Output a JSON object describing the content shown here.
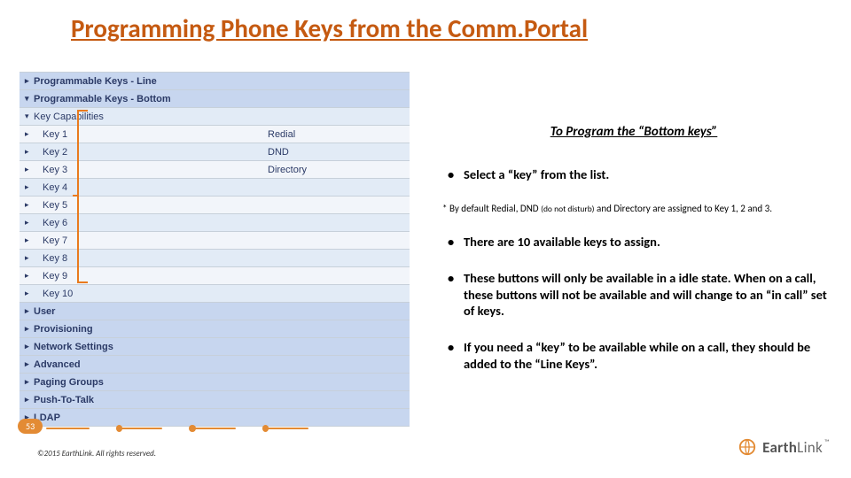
{
  "title": "Programming Phone Keys from the Comm.Portal",
  "panel": {
    "top_sections": [
      "Programmable Keys - Line",
      "Programmable Keys - Bottom"
    ],
    "capabilities_label": "Key Capabilities",
    "keys": [
      {
        "label": "Key 1",
        "value": "Redial"
      },
      {
        "label": "Key 2",
        "value": "DND"
      },
      {
        "label": "Key 3",
        "value": "Directory"
      },
      {
        "label": "Key 4",
        "value": ""
      },
      {
        "label": "Key 5",
        "value": ""
      },
      {
        "label": "Key 6",
        "value": ""
      },
      {
        "label": "Key 7",
        "value": ""
      },
      {
        "label": "Key 8",
        "value": ""
      },
      {
        "label": "Key 9",
        "value": ""
      },
      {
        "label": "Key 10",
        "value": ""
      }
    ],
    "bottom_sections": [
      "User",
      "Provisioning",
      "Network Settings",
      "Advanced",
      "Paging Groups",
      "Push-To-Talk",
      "LDAP"
    ]
  },
  "content": {
    "subhead": "To Program the “Bottom keys”",
    "bullets_a": [
      "Select a “key” from the list."
    ],
    "note_pre": "* By default Redial, DND ",
    "note_small": "(do not disturb)",
    "note_post": " and Directory are assigned to Key 1, 2 and 3.",
    "bullets_b": [
      "There are 10 available keys to assign.",
      "These buttons will only be available in a idle state. When on a call, these buttons will not be available and will change to an “in call” set of keys.",
      "If you need a “key” to be available while on a call, they should be added to the “Line Keys”."
    ]
  },
  "footer": {
    "page": "53",
    "copyright": "©2015 EarthLink. All rights reserved.",
    "brand_bold": "Earth",
    "brand_rest": "Link",
    "tm": "™"
  }
}
